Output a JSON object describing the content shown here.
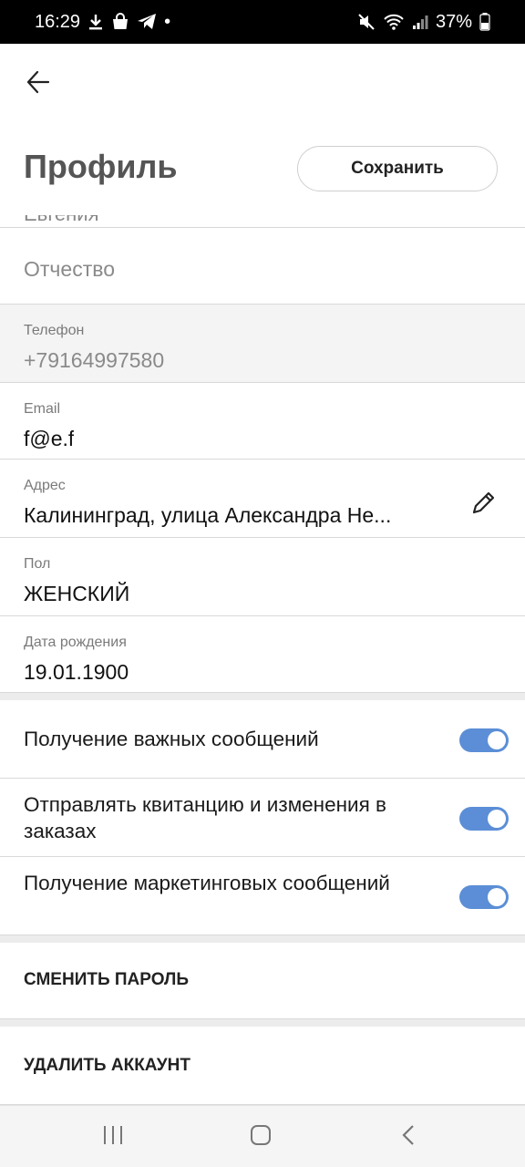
{
  "status_bar": {
    "time": "16:29",
    "dot": "•",
    "battery": "37%"
  },
  "header": {
    "back_icon": "back-arrow-icon",
    "title": "Профиль",
    "save_label": "Сохранить"
  },
  "form": {
    "cut_value": "Евгения",
    "patronymic_placeholder": "Отчество",
    "phone_label": "Телефон",
    "phone_value": "+79164997580",
    "email_label": "Email",
    "email_value": "f@e.f",
    "address_label": "Адрес",
    "address_value": "Калининград, улица Александра Не...",
    "gender_label": "Пол",
    "gender_value": "ЖЕНСКИЙ",
    "birth_label": "Дата рождения",
    "birth_value": "19.01.1900"
  },
  "notifications": [
    {
      "label": "Получение важных сообщений",
      "on": true
    },
    {
      "label": "Отправлять квитанцию и изменения в заказах",
      "on": true
    },
    {
      "label": "Получение маркетинговых сообщений",
      "on": true
    }
  ],
  "actions": {
    "change_password": "СМЕНИТЬ ПАРОЛЬ",
    "delete_account": "УДАЛИТЬ АККАУНТ"
  },
  "colors": {
    "toggle_on": "#5b8ed6",
    "status_bar_bg": "#000000"
  }
}
